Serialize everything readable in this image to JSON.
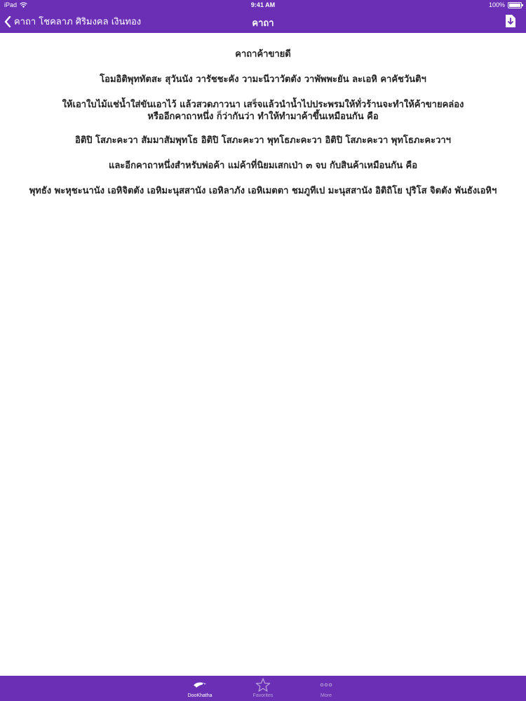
{
  "status_bar": {
    "device": "iPad",
    "time": "9:41 AM",
    "battery": "100%"
  },
  "navbar": {
    "back_label": "คาถา โชคลาภ ศิริมงคล เงินทอง",
    "title": "คาถา",
    "icons": {
      "back": "chevron-left-icon",
      "download": "download-icon"
    }
  },
  "content": {
    "lines": [
      "คาถาค้าขายดี",
      "โอมอิติพุททัตสะ สุวันนัง วารัชชะคัง วามะนีวาวัตตัง วาพัพพะยัน ละเอหิ คาคัชวันติฯ"
    ],
    "paragraph": [
      "ให้เอาใบไม้แช่น้ำใส่ขันเอาไว้ แล้วสวดภาวนา เสร็จแล้วนำน้ำไปประพรมให้ทั่วร้านจะทำให้ค้าขายคล่อง",
      "หรืออีกคาถาหนึ่ง ก็ว่ากันว่า ทำให้ทำมาค้าขึ้นเหมือนกัน คือ"
    ],
    "lines_after": [
      "อิติปิ โสภะคะวา สัมมาสัมพุทโธ อิติปิ โสภะคะวา พุทโธภะคะวา อิติปิ โสภะคะวา พุทโธภะคะวาฯ",
      "และอีกคาถาหนึ่งสำหรับพ่อค้า แม่ค้าที่นิยมเสกเป่า ๓ จบ กับสินค้าเหมือนกัน คือ",
      "พุทธัง พะหุชะนานัง เอหิจิตตัง เอหิมะนุสสานัง เอหิลาภัง เอหิเมตตา ชมภูทีเป มะนุสสานัง อิติถิโย ปุริโส จิตตัง พันธังเอหิฯ"
    ]
  },
  "tabbar": {
    "tabs": [
      {
        "label": "DooKhatha",
        "icon": "dookhatha-icon",
        "active": true
      },
      {
        "label": "Favorites",
        "icon": "star-icon",
        "active": false
      },
      {
        "label": "More",
        "icon": "more-dots-icon",
        "active": false
      }
    ]
  },
  "colors": {
    "brand": "#6a2fb5",
    "inactive_tab": "#b9a4d8",
    "text": "#222222"
  }
}
